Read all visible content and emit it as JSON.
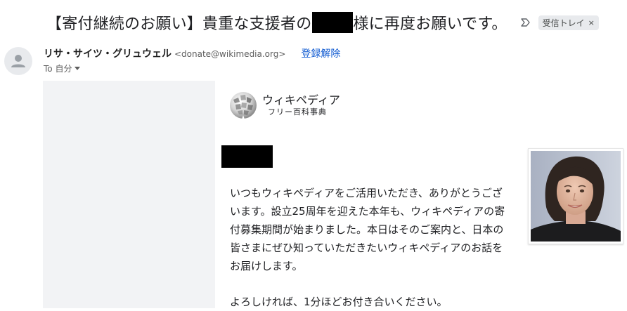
{
  "email": {
    "subject_part1": "【寄付継続のお願い】貴重な支援者の",
    "subject_part2": "様に再度お願いです。",
    "label": "受信トレイ",
    "label_close": "×",
    "sender": {
      "name": "リサ・サイツ・グリュウェル",
      "email": "<donate@wikimedia.org>",
      "unsubscribe": "登録解除"
    },
    "to": "To 自分"
  },
  "logo": {
    "name": "ウィキペディア",
    "tagline": "フリー百科事典"
  },
  "body": {
    "paragraph1": "いつもウィキペディアをご活用いただき、ありがとうございます。設立25周年を迎えた本年も、ウィキペディアの寄付募集期間が始まりました。本日はそのご案内と、日本の皆さまにぜひ知っていただきたいウィキペディアのお話をお届けします。",
    "paragraph2": "よろしければ、1分ほどお付き合いください。"
  },
  "icons": {
    "importance": "importance-marker-icon",
    "avatar": "default-avatar-icon",
    "caret": "caret-down-icon",
    "globe": "wikipedia-globe-logo"
  },
  "colors": {
    "link": "#0b57d0",
    "chip_bg": "#e8eaed",
    "panel_bg": "#f2f3f5",
    "redaction": "#000000"
  }
}
